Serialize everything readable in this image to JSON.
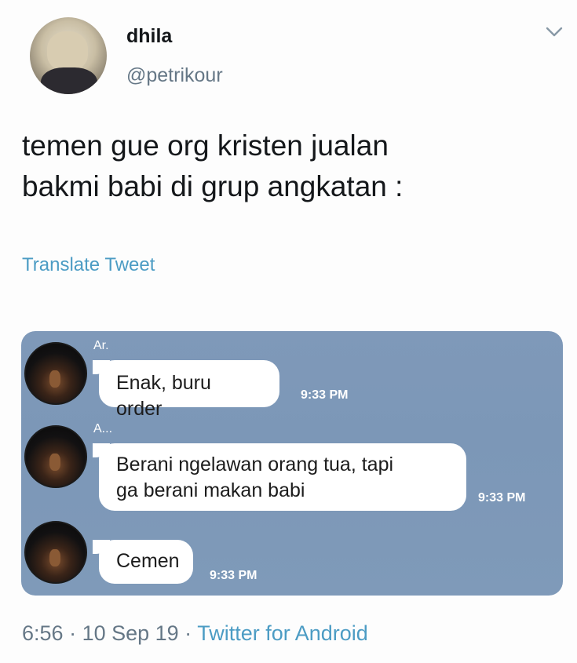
{
  "user": {
    "display_name": "dhila",
    "handle": "@petrikour"
  },
  "tweet": {
    "text_line1": "temen gue org kristen jualan",
    "text_line2": "bakmi babi di grup angkatan :",
    "translate_label": "Translate Tweet"
  },
  "chat": {
    "messages": [
      {
        "sender": "Ar.",
        "lines": [
          "Enak, buru order"
        ],
        "time": "9:33 PM"
      },
      {
        "sender": "A...",
        "lines": [
          "Berani ngelawan orang tua, tapi",
          "ga berani makan babi"
        ],
        "time": "9:33 PM"
      },
      {
        "sender": "",
        "lines": [
          "Cemen"
        ],
        "time": "9:33 PM"
      }
    ]
  },
  "footer": {
    "time": "6:56",
    "sep1": " · ",
    "date": "10 Sep 19",
    "sep2": " · ",
    "source": "Twitter for Android"
  },
  "colors": {
    "link": "#4c9cc4",
    "chat_background": "#7f99b9",
    "muted": "#657786"
  },
  "icons": {
    "caret": "chevron-down-icon"
  }
}
